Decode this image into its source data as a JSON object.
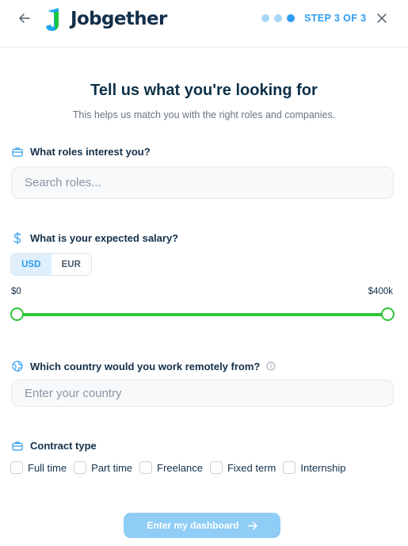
{
  "header": {
    "brand": "Jobgether",
    "step_label": "STEP 3 OF 3",
    "step_count": 3,
    "current_step": 3
  },
  "page": {
    "title": "Tell us what you're looking for",
    "subtitle": "This helps us match you with the right roles and companies."
  },
  "roles": {
    "label": "What roles interest you?",
    "placeholder": "Search roles...",
    "value": ""
  },
  "salary": {
    "label": "What is your expected salary?",
    "currencies": [
      "USD",
      "EUR"
    ],
    "selected_currency": "USD",
    "min_label": "$0",
    "max_label": "$400k",
    "range_low_fraction": 0,
    "range_high_fraction": 1
  },
  "country": {
    "label": "Which country would you work remotely from?",
    "placeholder": "Enter your country",
    "value": ""
  },
  "contract": {
    "label": "Contract type",
    "options": [
      {
        "label": "Full time",
        "checked": false
      },
      {
        "label": "Part time",
        "checked": false
      },
      {
        "label": "Freelance",
        "checked": false
      },
      {
        "label": "Fixed term",
        "checked": false
      },
      {
        "label": "Internship",
        "checked": false
      }
    ]
  },
  "submit": {
    "label": "Enter my dashboard"
  },
  "colors": {
    "accent": "#2d9cf0",
    "slider": "#2fc53a",
    "title": "#0d3148",
    "submit_bg": "#8fcdf6"
  },
  "icons": {
    "back": "arrow-left-icon",
    "close": "close-icon",
    "roles": "briefcase-icon",
    "salary": "dollar-icon",
    "country": "globe-icon",
    "info": "info-icon",
    "contract": "briefcase-icon",
    "submit": "arrow-right-icon"
  }
}
